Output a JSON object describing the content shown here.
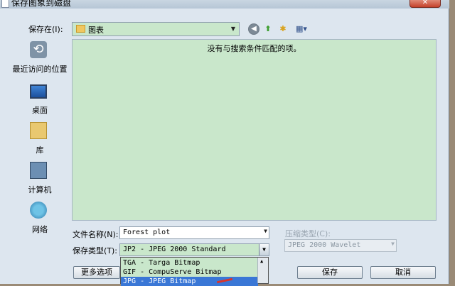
{
  "window": {
    "title": "保存图象到磁盘",
    "close_label": "✕"
  },
  "toolbar": {
    "save_in_label": "保存在(I):",
    "location": "图表",
    "back_icon": "back-arrow-icon",
    "up_icon": "up-folder-icon",
    "new_folder_icon": "new-folder-icon",
    "views_icon": "views-menu-icon"
  },
  "places": [
    {
      "label": "最近访问的位置",
      "icon": "recent-places-icon"
    },
    {
      "label": "桌面",
      "icon": "desktop-icon"
    },
    {
      "label": "库",
      "icon": "library-icon"
    },
    {
      "label": "计算机",
      "icon": "computer-icon"
    },
    {
      "label": "网络",
      "icon": "network-icon"
    }
  ],
  "file_list": {
    "empty_message": "没有与搜索条件匹配的项。"
  },
  "form": {
    "filename_label": "文件名称(N):",
    "filename_value": "Forest plot",
    "filetype_label": "保存类型(T):",
    "filetype_value": "JP2 - JPEG 2000 Standard",
    "compression_label": "压缩类型(C):",
    "compression_value": "JPEG 2000 Wavelet"
  },
  "filetype_options": [
    {
      "label": "TGA - Targa Bitmap",
      "selected": false
    },
    {
      "label": "GIF - CompuServe Bitmap",
      "selected": false
    },
    {
      "label": "JPG - JPEG Bitmap",
      "selected": true
    }
  ],
  "buttons": {
    "more_options": "更多选项",
    "save": "保存",
    "cancel": "取消"
  },
  "colors": {
    "list_background": "#c9e7cb",
    "selection": "#3a77d6",
    "annotation_arrow": "#d9342b"
  }
}
